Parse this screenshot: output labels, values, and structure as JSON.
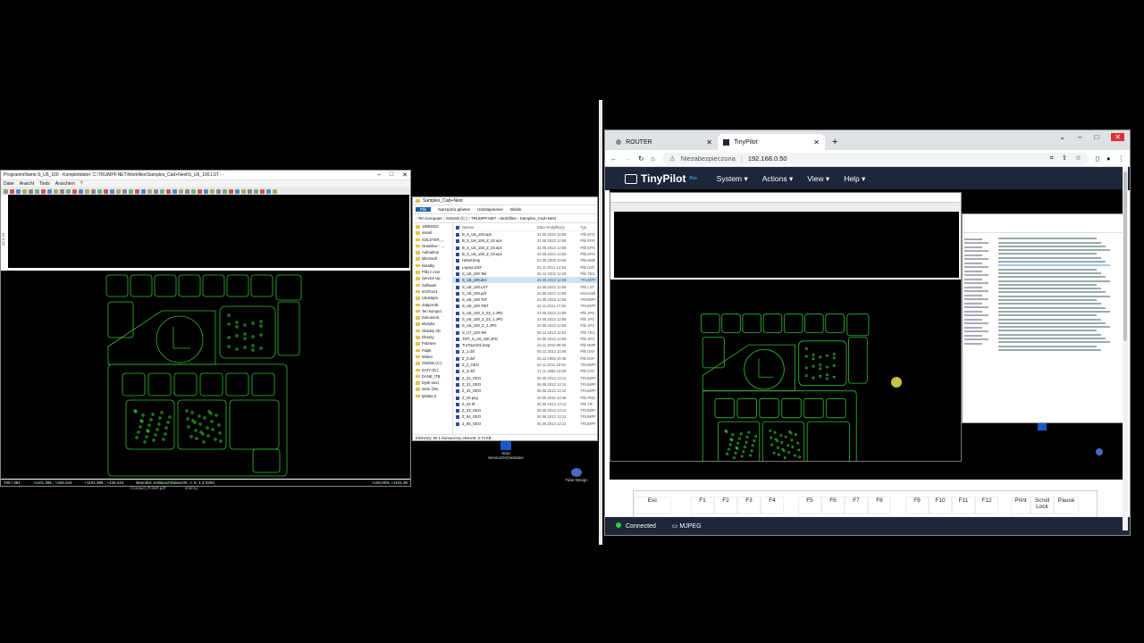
{
  "cad": {
    "title": "ProgrammName:S_U6_100 - Komplettdatei: C:\\TRUMPF.NET\\Workfiles\\Samples_Cad+Nest\\S_U6_100.LST - -",
    "menu": [
      "Datei",
      "Ansicht",
      "Tools",
      "Ansichten",
      "?"
    ],
    "status": [
      "700 / 381",
      "+1101.395 ; +426.344",
      "+1101.395 ; +426.344",
      "Beendet: eAbbruchStatusOK -> S: 1 Z:3293",
      "+100.00% +1101.39"
    ],
    "bottom_label_1": "Conduct_Polish.pdf",
    "bottom_label_2": "sntmrg",
    "side_label": "2D 8 23"
  },
  "explorer": {
    "title": "Samples_Cad+Nest",
    "tabs": [
      "Plik",
      "Narzędzia główne",
      "Udostępnianie",
      "Widok"
    ],
    "address": "›  Ten komputer  ›  OSDisk (C:)  ›  TRUMPF.NET  ›  Workfiles  ›  Samples_Cad+Nest",
    "columns": [
      "Nazwa",
      "Data modyfikacji",
      "Typ"
    ],
    "nav": [
      "18082023",
      "install",
      "KOLSTER_...",
      "OneDrive - ...",
      "Aufnahme",
      "Microsoft",
      "Notatky",
      "Pliki z czat",
      "Service Up",
      "Software",
      "sn3Trac4",
      "Udostępn.",
      "Załączniki",
      "Ten komput.",
      "Dokument.",
      "Muzyka",
      "Obiekty 3D",
      "Obrazy",
      "Pobrane",
      "Pulpit",
      "Wideo",
      "OSDisk (C:)",
      "DATA (D:)",
      "DANE_ITB",
      "Dysk sieci",
      "store (\\\\se",
      "tpldata (\\"
    ],
    "files": [
      {
        "name": "B_S_U6_100.eps",
        "date": "24.05.2023 12:59",
        "type": "Plik EPS"
      },
      {
        "name": "B_S_U6_100_Z_02.eps",
        "date": "24.05.2023 12:59",
        "type": "Plik EPS"
      },
      {
        "name": "B_S_U6_100_Z_03.eps",
        "date": "24.05.2023 12:59",
        "type": "Plik EPS"
      },
      {
        "name": "B_S_U6_100_Z_04.eps",
        "date": "24.05.2023 12:59",
        "type": "Plik EPS"
      },
      {
        "name": "Hebel.bmp",
        "date": "02.09.2008 19:06",
        "type": "Plik BMP"
      },
      {
        "name": "Layout.DXF",
        "date": "02.11.2011 14:18",
        "type": "Plik DXF"
      },
      {
        "name": "S_U6_100.Teil",
        "date": "05.12.2003 12:29",
        "type": "Plik TEIL"
      },
      {
        "name": "S_U6_100.dnc",
        "date": "24.05.2023 12:59",
        "type": "TRUMPF"
      },
      {
        "name": "S_U6_100.LST",
        "date": "24.05.2023 12:59",
        "type": "Plik LST"
      },
      {
        "name": "S_U6_100.pdf",
        "date": "24.05.2023 12:59",
        "type": "Microsoft"
      },
      {
        "name": "S_U6_100.TAT",
        "date": "24.05.2023 12:59",
        "type": "TRUMPF"
      },
      {
        "name": "S_U6_100.TMT",
        "date": "24.11.2011 17:26",
        "type": "TRUMPF"
      },
      {
        "name": "S_U6_100_Z_02_1.JPG",
        "date": "24.05.2023 12:59",
        "type": "Plik JPG"
      },
      {
        "name": "S_U6_100_Z_03_1.JPG",
        "date": "24.05.2023 12:59",
        "type": "Plik JPG"
      },
      {
        "name": "S_U6_100_Z_2.JPG",
        "date": "24.05.2023 12:59",
        "type": "Plik JPG"
      },
      {
        "name": "S_U7_100.Teil",
        "date": "05.12.2013 11:53",
        "type": "Plik TEIL"
      },
      {
        "name": "TMT_S_U6_100.JPG",
        "date": "24.05.2023 12:59",
        "type": "Plik JPG"
      },
      {
        "name": "TruTops101.bmp",
        "date": "15.11.2010 09:05",
        "type": "Plik BMP"
      },
      {
        "name": "Z_1.dxf",
        "date": "05.12.2013 10:08",
        "type": "Plik DXF"
      },
      {
        "name": "Z_2.dxf",
        "date": "05.12.1994 10:46",
        "type": "Plik DXF"
      },
      {
        "name": "Z_2_GEO",
        "date": "02.11.2011 10:50",
        "type": "TRUMPF"
      },
      {
        "name": "Z_3.dxf",
        "date": "17.11.1998 13:09",
        "type": "Plik DXF"
      },
      {
        "name": "Z_23_GEO",
        "date": "06.06.2013 13:12",
        "type": "TRUMPF"
      },
      {
        "name": "Z_31_GEO",
        "date": "06.06.2013 13:12",
        "type": "TRUMPF"
      },
      {
        "name": "Z_32_GEO",
        "date": "06.06.2013 13:12",
        "type": "TRUMPF"
      },
      {
        "name": "Z_32.png",
        "date": "20.05.2010 13:49",
        "type": "Plik PNG"
      },
      {
        "name": "Z_32.tif",
        "date": "06.06.2013 13:12",
        "type": "Plik TIF"
      },
      {
        "name": "Z_33_GEO",
        "date": "06.06.2013 13:12",
        "type": "TRUMPF"
      },
      {
        "name": "Z_94_GEO",
        "date": "06.06.2013 13:12",
        "type": "TRUMPF"
      },
      {
        "name": "Z_95_GEO",
        "date": "06.06.2013 13:12",
        "type": "TRUMPF"
      }
    ],
    "status": "Elementy: 50     1 zaznaczony element: 2,73 KB"
  },
  "desktop": {
    "icon1": "Start ServiceOrchestrator",
    "icon2": "Tube Design"
  },
  "browser": {
    "tabs": [
      {
        "label": "ROUTER"
      },
      {
        "label": "TinyPilot"
      }
    ],
    "address_warning": "Niezabezpieczona",
    "url": "192.168.0.50",
    "tinypilot": {
      "logo": "TinyPilot",
      "logo_badge": "Pro",
      "menus": [
        "System ▾",
        "Actions ▾",
        "View ▾",
        "Help ▾"
      ]
    },
    "keys": [
      "Esc",
      "F1",
      "F2",
      "F3",
      "F4",
      "F5",
      "F6",
      "F7",
      "F8",
      "F9",
      "F10",
      "F11",
      "F12",
      "Print",
      "Scroll Lock",
      "Pause"
    ],
    "status_connected": "Connected",
    "status_stream": "MJPEG"
  },
  "colors": {
    "cad_green": "#2fbf2f",
    "tinypilot_nav": "#1d2739",
    "selection": "#cce4f7"
  }
}
